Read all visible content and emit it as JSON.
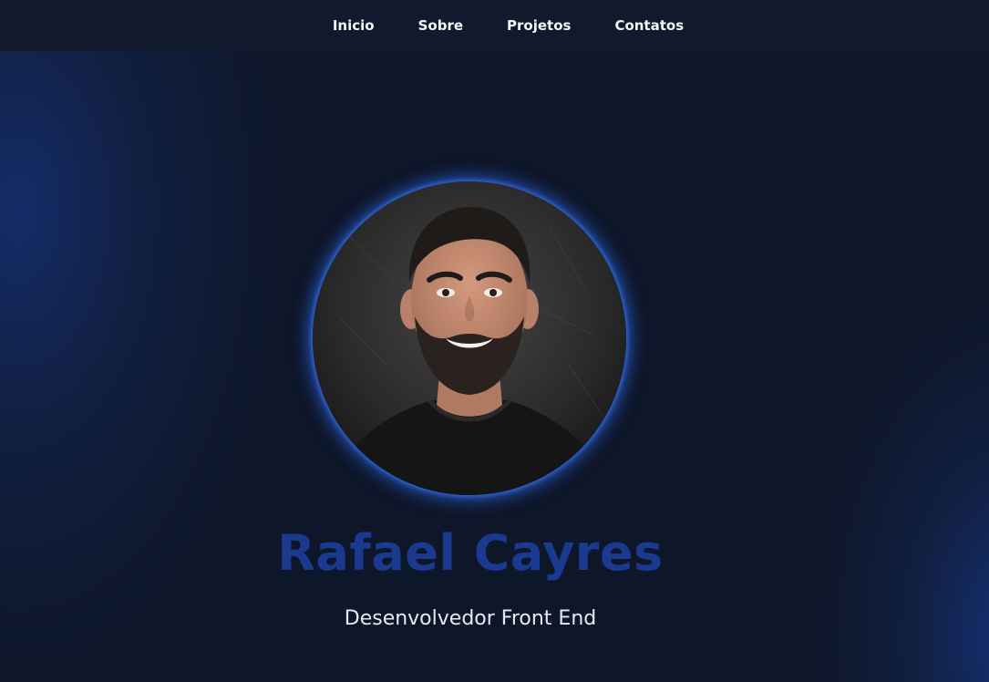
{
  "nav": {
    "items": [
      {
        "label": "Inicio"
      },
      {
        "label": "Sobre"
      },
      {
        "label": "Projetos"
      },
      {
        "label": "Contatos"
      }
    ]
  },
  "hero": {
    "avatar_icon": "profile-photo",
    "name": "Rafael Cayres",
    "role": "Desenvolvedor Front End"
  },
  "colors": {
    "background": "#0e1629",
    "navbar": "#101a2c",
    "name_accent": "#1a3a8f",
    "glow": "#285fd2",
    "text": "#e6e9ef"
  }
}
